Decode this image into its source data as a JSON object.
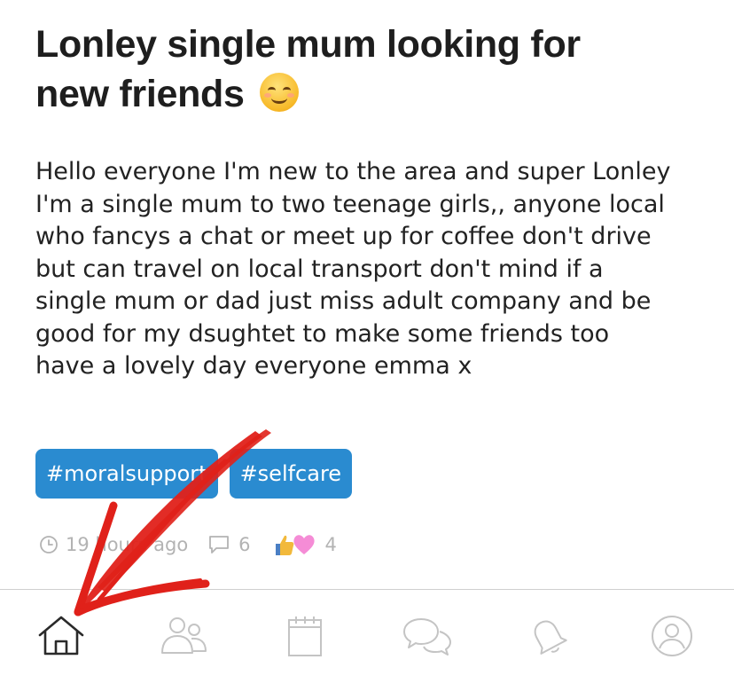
{
  "post": {
    "title": "Lonley single mum looking for new friends",
    "title_lines": [
      "Lonley single mum looking for",
      "new friends"
    ],
    "title_emoji": "smiling-face-emoji",
    "body_lines": [
      "Hello everyone I'm new to the area and super Lonley",
      "I'm a single mum to two teenage girls,, anyone local",
      "who fancys a chat or meet up for coffee don't drive",
      "but can travel on local transport don't mind if a",
      "single mum or dad just miss adult company and be",
      "good for my dsughtet to make some friends too",
      "have a lovely day everyone emma x"
    ],
    "tags": [
      "#moralsupport",
      "#selfcare"
    ],
    "meta": {
      "time": "19 hours ago",
      "comments": "6",
      "reactions": "4",
      "reaction_icons": [
        "thumbs-up-icon",
        "heart-icon"
      ]
    }
  },
  "nav": {
    "items": [
      {
        "icon": "home-icon",
        "active": true
      },
      {
        "icon": "people-icon",
        "active": false
      },
      {
        "icon": "calendar-icon",
        "active": false
      },
      {
        "icon": "chat-icon",
        "active": false
      },
      {
        "icon": "bell-icon",
        "active": false
      },
      {
        "icon": "profile-icon",
        "active": false
      }
    ]
  },
  "colors": {
    "tag_bg": "#2a8bd0",
    "text": "#1e1e1e",
    "muted": "#b3b3b3",
    "annotation_arrow": "#e0211a"
  }
}
